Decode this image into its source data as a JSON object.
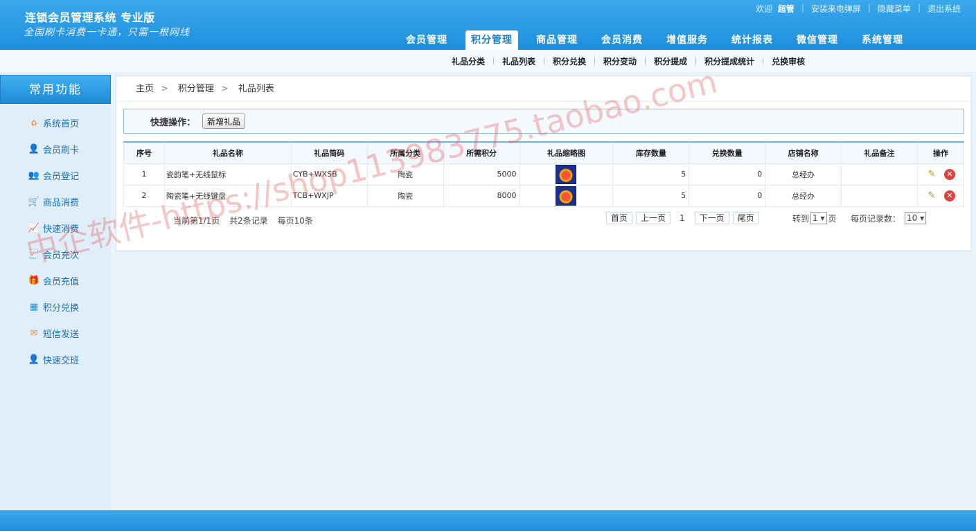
{
  "header": {
    "title": "连锁会员管理系统 专业版",
    "slogan": "全国刷卡消费一卡通，只需一根网线",
    "welcome": "欢迎",
    "username": "超管",
    "links": [
      "安装来电弹屏",
      "隐藏菜单",
      "退出系统"
    ]
  },
  "mainnav": [
    "会员管理",
    "积分管理",
    "商品管理",
    "会员消费",
    "增值服务",
    "统计报表",
    "微信管理",
    "系统管理"
  ],
  "subnav": [
    "礼品分类",
    "礼品列表",
    "积分兑换",
    "积分变动",
    "积分提成",
    "积分提成统计",
    "兑换审核"
  ],
  "sidebar": {
    "title": "常用功能",
    "items": [
      {
        "label": "系统首页",
        "icon": "home-icon"
      },
      {
        "label": "会员刷卡",
        "icon": "user-card-icon"
      },
      {
        "label": "会员登记",
        "icon": "users-icon"
      },
      {
        "label": "商品消费",
        "icon": "cart-icon"
      },
      {
        "label": "快速消费",
        "icon": "chart-icon"
      },
      {
        "label": "会员充次",
        "icon": "register-icon"
      },
      {
        "label": "会员充值",
        "icon": "gift-box-icon"
      },
      {
        "label": "积分兑换",
        "icon": "gift-icon"
      },
      {
        "label": "短信发送",
        "icon": "mail-icon"
      },
      {
        "label": "快速交班",
        "icon": "handover-icon"
      }
    ]
  },
  "breadcrumb": [
    "主页",
    "积分管理",
    "礼品列表"
  ],
  "quick": {
    "label": "快捷操作：",
    "button": "新增礼品"
  },
  "table": {
    "headers": [
      "序号",
      "礼品名称",
      "礼品简码",
      "所属分类",
      "所需积分",
      "礼品缩略图",
      "库存数量",
      "兑换数量",
      "店铺名称",
      "礼品备注",
      "操作"
    ],
    "rows": [
      {
        "no": "1",
        "name": "瓷韵笔+无线鼠标",
        "code": "CYB+WXSB",
        "category": "陶瓷",
        "points": "5000",
        "stock": "5",
        "exchanged": "0",
        "store": "总经办",
        "remark": ""
      },
      {
        "no": "2",
        "name": "陶瓷笔+无线键盘",
        "code": "TCB+WXJP",
        "category": "陶瓷",
        "points": "8000",
        "stock": "5",
        "exchanged": "0",
        "store": "总经办",
        "remark": ""
      }
    ]
  },
  "pager": {
    "current": "当前第1/1页",
    "total": "共2条记录",
    "per_page": "每页10条",
    "first": "首页",
    "prev": "上一页",
    "page": "1",
    "next": "下一页",
    "last": "尾页",
    "goto_label": "转到",
    "goto_value": "1",
    "goto_suffix": "页",
    "per_label": "每页记录数：",
    "per_value": "10"
  },
  "watermark": "中企软件-https://shop113983775.taobao.com",
  "colors": {
    "accent": "#1e8fdc",
    "sidebar_link": "#1b6fb3"
  }
}
